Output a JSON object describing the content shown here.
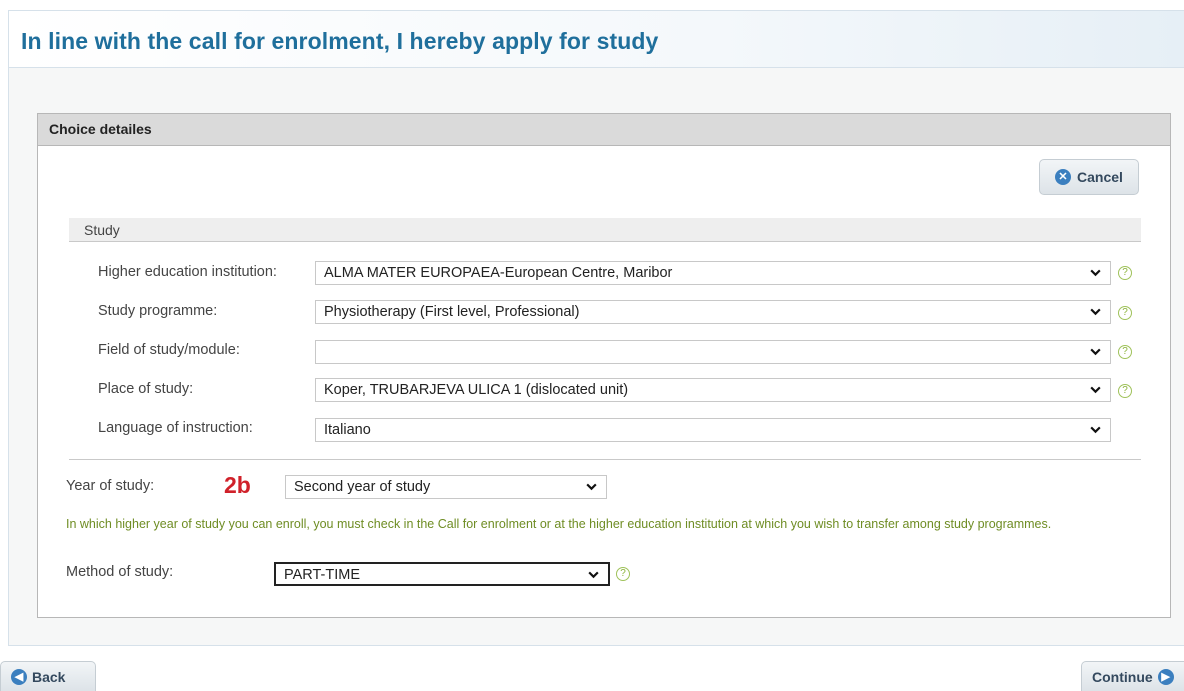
{
  "page": {
    "title": "In line with the call for enrolment, I hereby apply for study"
  },
  "panel": {
    "title": "Choice detailes",
    "cancel_label": "Cancel"
  },
  "study": {
    "section_title": "Study",
    "fields": {
      "institution": {
        "label": "Higher education institution:",
        "value": "ALMA MATER EUROPAEA-European Centre, Maribor"
      },
      "programme": {
        "label": "Study programme:",
        "value": "Physiotherapy (First level, Professional)"
      },
      "field_module": {
        "label": "Field of study/module:",
        "value": ""
      },
      "place": {
        "label": "Place of study:",
        "value": "Koper, TRUBARJEVA ULICA 1 (dislocated unit)"
      },
      "language": {
        "label": "Language of instruction:",
        "value": "Italiano"
      }
    }
  },
  "year": {
    "label": "Year of study:",
    "annotation": "2b",
    "value": "Second year of study",
    "info": "In which higher year of study you can enroll, you must check in the Call for enrolment or at the higher education institution at which you wish to transfer among study programmes."
  },
  "method": {
    "label": "Method of study:",
    "value": "PART-TIME"
  },
  "footer": {
    "back_label": "Back",
    "continue_label": "Continue"
  },
  "colors": {
    "title_blue": "#1f6f9c",
    "annotation_red": "#d0212a",
    "info_green": "#6f8d24",
    "button_icon_blue": "#3b7fbf"
  },
  "icons": {
    "cancel": "x-circle-icon",
    "dropdown": "chevron-down-icon",
    "help": "question-circle-icon",
    "back": "arrow-left-circle-icon",
    "continue": "arrow-right-circle-icon"
  }
}
